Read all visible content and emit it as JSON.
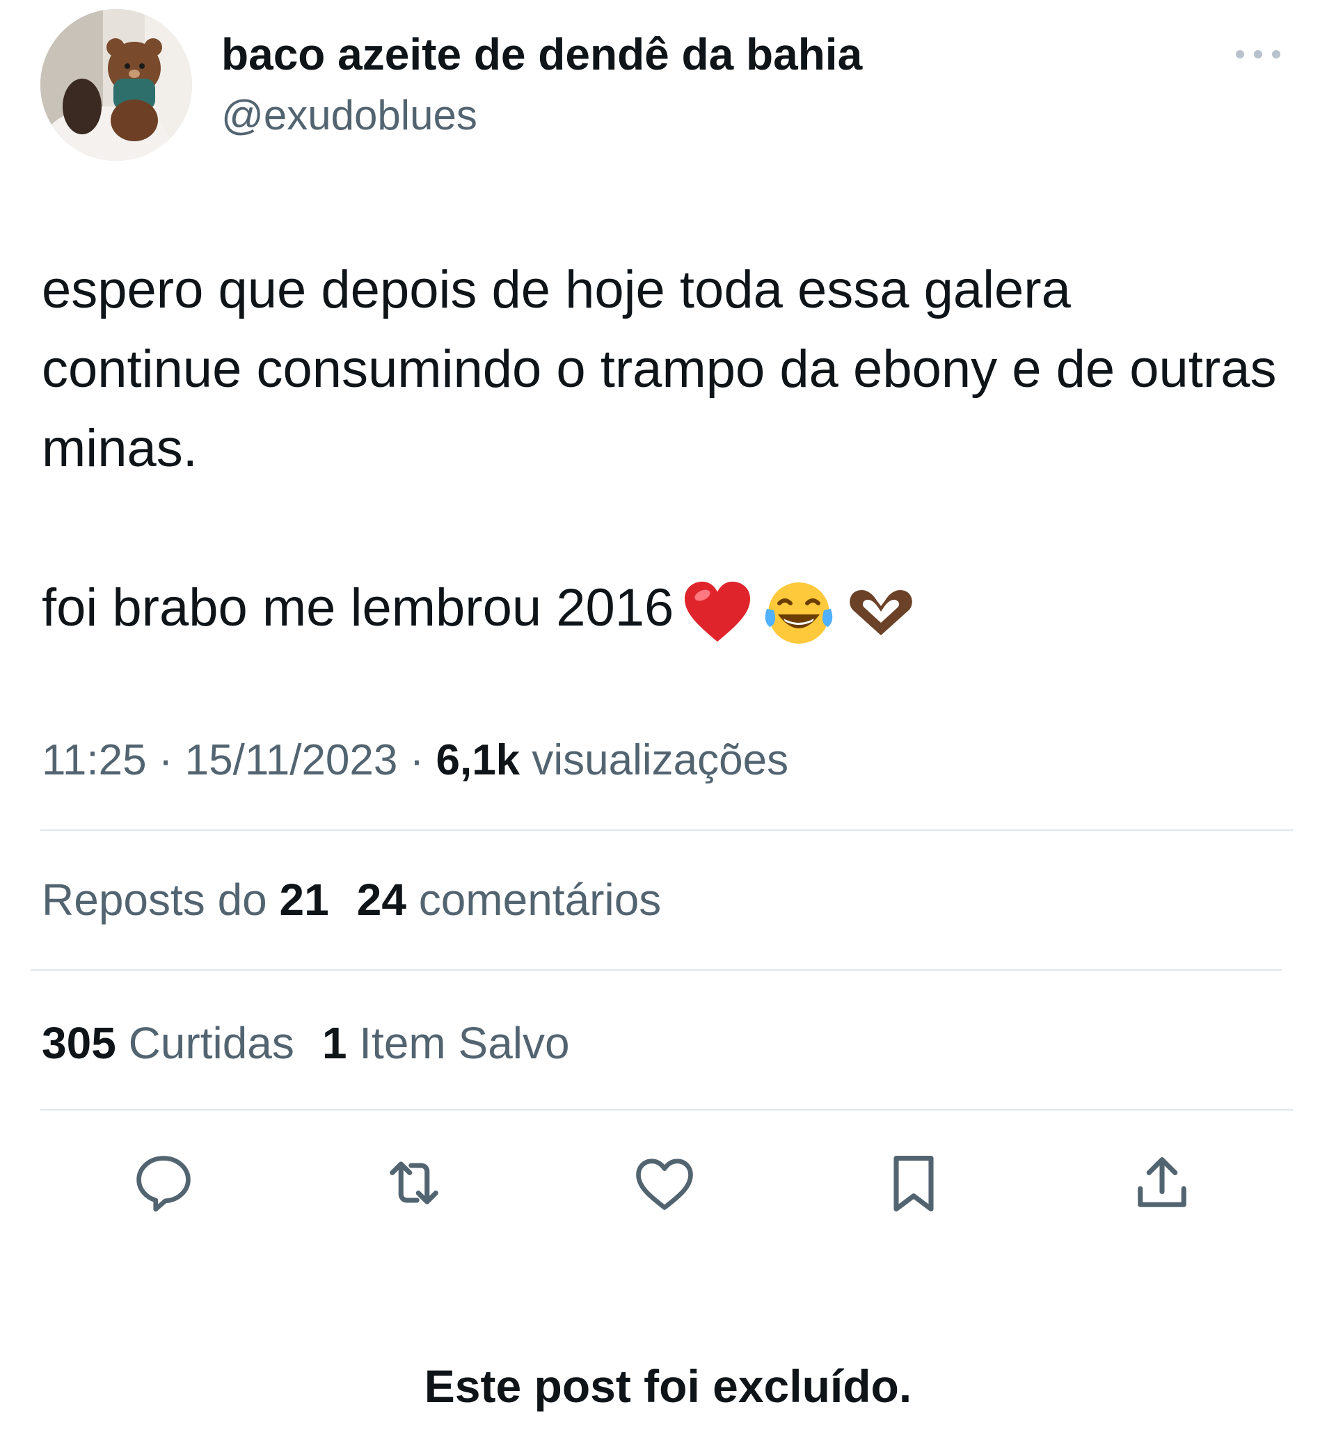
{
  "author": {
    "display_name": "baco azeite de dendê da bahia",
    "handle": "@exudoblues"
  },
  "more_icon": "more-horizontal-icon",
  "tweet": {
    "paragraph1": "espero que depois de hoje toda essa galera continue consumindo o trampo da ebony e de outras minas.",
    "paragraph2": "foi brabo me lembrou 2016",
    "emojis": [
      "red-heart-emoji",
      "tears-of-joy-emoji",
      "heart-hands-emoji"
    ]
  },
  "meta": {
    "time": "11:25",
    "separator1": " · ",
    "date": "15/11/2023",
    "separator2": " · ",
    "views_count": "6,1k",
    "views_label": " visualizações"
  },
  "stats": {
    "reposts_label": "Reposts do ",
    "reposts_count": "21",
    "comments_count": "24",
    "comments_label": " comentários",
    "likes_count": "305",
    "likes_label": " Curtidas",
    "saves_count": "1",
    "saves_label": " Item Salvo"
  },
  "actions": [
    {
      "icon": "reply-icon"
    },
    {
      "icon": "repost-icon"
    },
    {
      "icon": "like-icon"
    },
    {
      "icon": "bookmark-icon"
    },
    {
      "icon": "share-icon"
    }
  ],
  "notice": "Este post foi excluído.",
  "colors": {
    "text": "#0f1419",
    "secondary": "#536471",
    "divider": "#e1e6ea",
    "icon": "#536471"
  }
}
